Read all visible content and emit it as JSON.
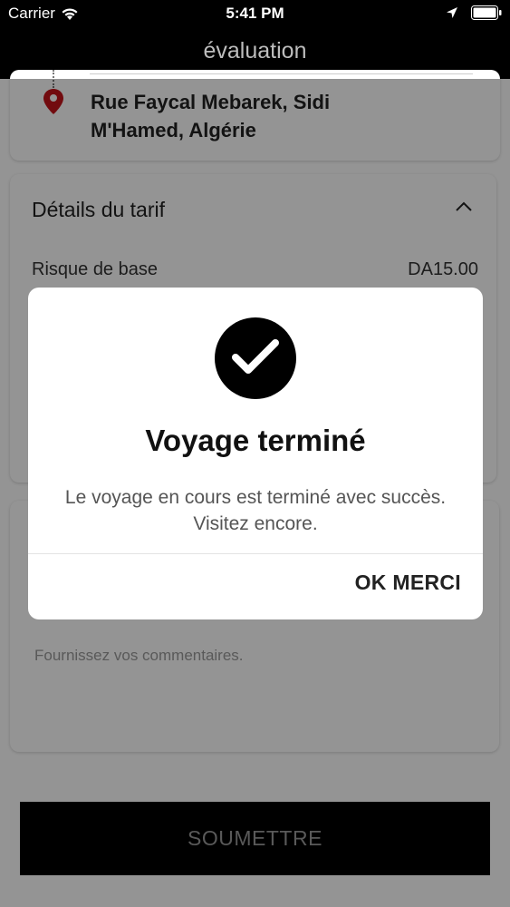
{
  "status_bar": {
    "carrier": "Carrier",
    "time": "5:41 PM"
  },
  "nav": {
    "title": "évaluation"
  },
  "trip": {
    "destination_address": "Rue Faycal Mebarek,  Sidi M'Hamed,  Algérie"
  },
  "fare": {
    "section_title": "Détails du tarif",
    "rows": [
      {
        "label": "Risque de base",
        "value": "DA15.00"
      }
    ]
  },
  "feedback": {
    "placeholder": "Fournissez vos commentaires."
  },
  "submit_label": "SOUMETTRE",
  "dialog": {
    "title": "Voyage terminé",
    "message": "Le voyage en cours est terminé avec succès. Visitez encore.",
    "ok_label": "OK MERCI"
  },
  "colors": {
    "pin_red": "#c4141b",
    "nav_background": "#000000",
    "overlay": "rgba(0,0,0,0.42)"
  },
  "icons": {
    "wifi": "wifi-icon",
    "location": "location-arrow-icon",
    "battery": "battery-icon",
    "pin": "map-pin-icon",
    "chevron": "chevron-up-icon",
    "check": "checkmark-icon"
  }
}
